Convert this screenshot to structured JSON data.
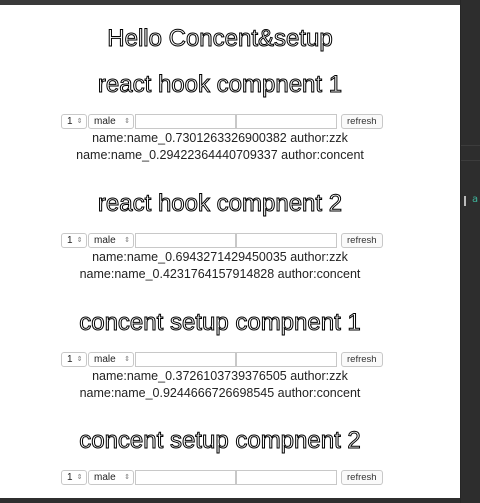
{
  "title": "Hello Concent&setup",
  "sections": [
    {
      "heading": "react hook compnent 1",
      "num": "1",
      "gender": "male",
      "refresh": "refresh",
      "lines": [
        "name:name_0.7301263326900382 author:zzk",
        "name:name_0.29422364440709337 author:concent"
      ]
    },
    {
      "heading": "react hook compnent 2",
      "num": "1",
      "gender": "male",
      "refresh": "refresh",
      "lines": [
        "name:name_0.6943271429450035 author:zzk",
        "name:name_0.4231764157914828 author:concent"
      ]
    },
    {
      "heading": "concent setup compnent 1",
      "num": "1",
      "gender": "male",
      "refresh": "refresh",
      "lines": [
        "name:name_0.3726103739376505 author:zzk",
        "name:name_0.9244666726698545 author:concent"
      ]
    },
    {
      "heading": "concent setup compnent 2",
      "num": "1",
      "gender": "male",
      "refresh": "refresh",
      "lines": []
    }
  ],
  "side_tag": "a"
}
